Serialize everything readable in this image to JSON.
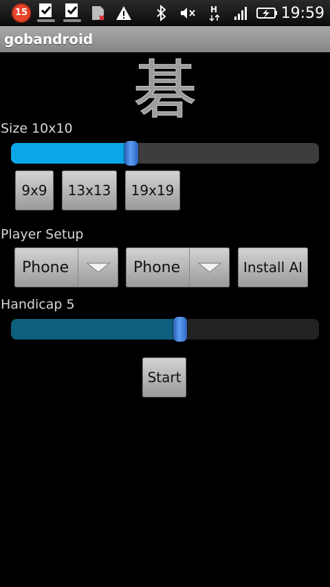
{
  "status_bar": {
    "notification_count": "15",
    "time": "19:59",
    "icons": [
      "task-done-icon",
      "task-done-icon",
      "sd-card-error-icon",
      "warning-icon",
      "bluetooth-icon",
      "mute-icon",
      "hspa-signal-icon",
      "signal-strength-icon",
      "battery-charging-icon"
    ]
  },
  "app": {
    "title": "gobandroid"
  },
  "logo": {
    "glyph": "碁"
  },
  "size_section": {
    "label": "Size 10x10",
    "slider_fraction": 0.39,
    "fill_color": "#0ba6e8",
    "buttons": [
      "9x9",
      "13x13",
      "19x19"
    ]
  },
  "player_section": {
    "label": "Player Setup",
    "player1_value": "Phone",
    "player2_value": "Phone",
    "install_ai_label": "Install AI"
  },
  "handicap_section": {
    "label": "Handicap 5",
    "slider_fraction": 0.55,
    "fill_color": "#0e5f7d"
  },
  "start_label": "Start"
}
